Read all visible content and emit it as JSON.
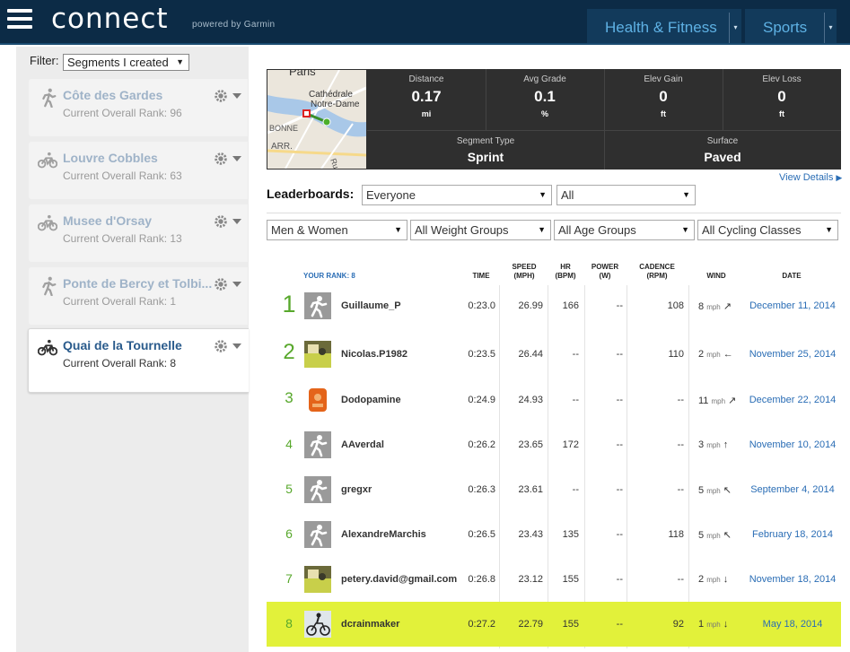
{
  "header": {
    "logo": "connect",
    "powered_by": "powered by Garmin",
    "nav": [
      {
        "label": "Health & Fitness"
      },
      {
        "label": "Sports"
      }
    ],
    "colors": {
      "bar": "#0c2b46",
      "nav_text": "#5eb1e4"
    }
  },
  "sidebar": {
    "filter_label": "Filter:",
    "filter_value": "Segments I created",
    "segments": [
      {
        "name": "Côte des Gardes",
        "rank": "Current Overall Rank: 96",
        "sport_icon": "running-icon",
        "active": false
      },
      {
        "name": "Louvre Cobbles",
        "rank": "Current Overall Rank: 63",
        "sport_icon": "cycling-icon",
        "active": false
      },
      {
        "name": "Musee d'Orsay",
        "rank": "Current Overall Rank: 13",
        "sport_icon": "cycling-icon",
        "active": false
      },
      {
        "name": "Ponte de Bercy et Tolbi...",
        "rank": "Current Overall Rank: 1",
        "sport_icon": "running-icon",
        "active": false
      },
      {
        "name": "Quai de la Tournelle",
        "rank": "Current Overall Rank: 8",
        "sport_icon": "cycling-icon",
        "active": true
      }
    ]
  },
  "map": {
    "labels": [
      "Paris",
      "Cathédrale",
      "Notre-Dame",
      "BONNE",
      "ARR.",
      "Rue M"
    ]
  },
  "stats": {
    "distance": {
      "label": "Distance",
      "value": "0.17",
      "unit": "mi"
    },
    "avg_grade": {
      "label": "Avg Grade",
      "value": "0.1",
      "unit": "%"
    },
    "elev_gain": {
      "label": "Elev Gain",
      "value": "0",
      "unit": "ft"
    },
    "elev_loss": {
      "label": "Elev Loss",
      "value": "0",
      "unit": "ft"
    },
    "segment_type": {
      "label": "Segment Type",
      "value": "Sprint"
    },
    "surface": {
      "label": "Surface",
      "value": "Paved"
    }
  },
  "view_details": "View Details",
  "leaderboards": {
    "label": "Leaderboards:",
    "filters": {
      "audience": "Everyone",
      "period": "All",
      "gender": "Men & Women",
      "weight": "All Weight Groups",
      "age": "All Age Groups",
      "class": "All Cycling Classes"
    },
    "your_rank": "YOUR RANK: 8",
    "columns": {
      "time": "TIME",
      "speed": [
        "SPEED",
        "(MPH)"
      ],
      "hr": [
        "HR",
        "(BPM)"
      ],
      "power": [
        "POWER",
        "(W)"
      ],
      "cadence": [
        "CADENCE",
        "(RPM)"
      ],
      "wind": "WIND",
      "date": "DATE"
    },
    "rows": [
      {
        "rank": "1",
        "name": "Guillaume_P",
        "avatar": "default-avatar",
        "time": "0:23.0",
        "speed": "26.99",
        "hr": "166",
        "power": "--",
        "cadence": "108",
        "wind": "8",
        "wind_unit": "mph",
        "wind_dir": "↗",
        "date": "December 11, 2014"
      },
      {
        "rank": "2",
        "name": "Nicolas.P1982",
        "avatar": "photo-avatar",
        "time": "0:23.5",
        "speed": "26.44",
        "hr": "--",
        "power": "--",
        "cadence": "110",
        "wind": "2",
        "wind_unit": "mph",
        "wind_dir": "←",
        "date": "November 25, 2014"
      },
      {
        "rank": "3",
        "name": "Dodopamine",
        "avatar": "orange-avatar",
        "time": "0:24.9",
        "speed": "24.93",
        "hr": "--",
        "power": "--",
        "cadence": "--",
        "wind": "11",
        "wind_unit": "mph",
        "wind_dir": "↗",
        "date": "December 22, 2014"
      },
      {
        "rank": "4",
        "name": "AAverdal",
        "avatar": "default-avatar",
        "time": "0:26.2",
        "speed": "23.65",
        "hr": "172",
        "power": "--",
        "cadence": "--",
        "wind": "3",
        "wind_unit": "mph",
        "wind_dir": "↑",
        "date": "November 10, 2014"
      },
      {
        "rank": "5",
        "name": "gregxr",
        "avatar": "default-avatar",
        "time": "0:26.3",
        "speed": "23.61",
        "hr": "--",
        "power": "--",
        "cadence": "--",
        "wind": "5",
        "wind_unit": "mph",
        "wind_dir": "↖",
        "date": "September 4, 2014"
      },
      {
        "rank": "6",
        "name": "AlexandreMarchis",
        "avatar": "default-avatar",
        "time": "0:26.5",
        "speed": "23.43",
        "hr": "135",
        "power": "--",
        "cadence": "118",
        "wind": "5",
        "wind_unit": "mph",
        "wind_dir": "↖",
        "date": "February 18, 2014"
      },
      {
        "rank": "7",
        "name": "petery.david@gmail.com",
        "avatar": "photo-avatar",
        "time": "0:26.8",
        "speed": "23.12",
        "hr": "155",
        "power": "--",
        "cadence": "--",
        "wind": "2",
        "wind_unit": "mph",
        "wind_dir": "↓",
        "date": "November 18, 2014"
      },
      {
        "rank": "8",
        "name": "dcrainmaker",
        "avatar": "cyclist-avatar",
        "time": "0:27.2",
        "speed": "22.79",
        "hr": "155",
        "power": "--",
        "cadence": "92",
        "wind": "1",
        "wind_unit": "mph",
        "wind_dir": "↓",
        "date": "May 18, 2014",
        "highlight": true
      }
    ],
    "colors": {
      "rank_green": "#58a82c",
      "highlight": "#e2f13a",
      "link_blue": "#2a6db5"
    }
  }
}
